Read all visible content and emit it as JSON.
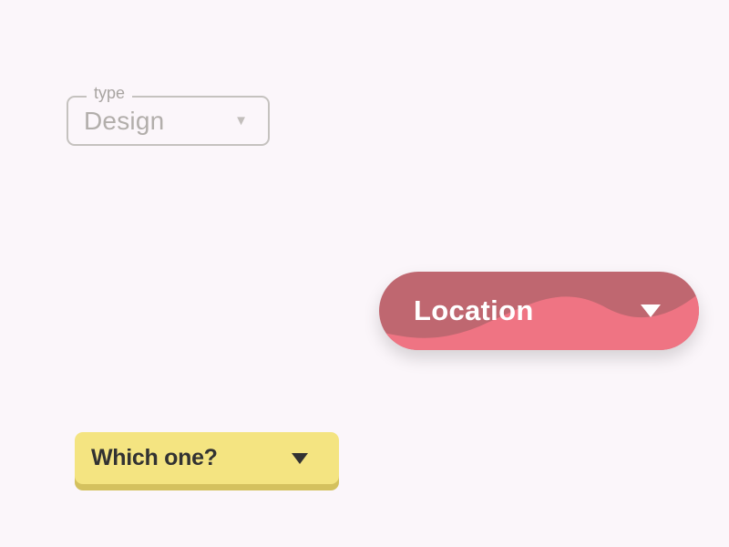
{
  "dropdowns": {
    "type": {
      "label": "type",
      "value": "Design"
    },
    "location": {
      "label": "Location"
    },
    "which": {
      "label": "Which one?"
    }
  },
  "colors": {
    "background": "#fbf6fa",
    "outline_border": "#c5c2bf",
    "outline_text": "#b2aeab",
    "pill_dark": "#bf6770",
    "pill_light": "#ef7483",
    "yellow_top": "#f4e481",
    "yellow_shadow": "#d4c15e"
  }
}
